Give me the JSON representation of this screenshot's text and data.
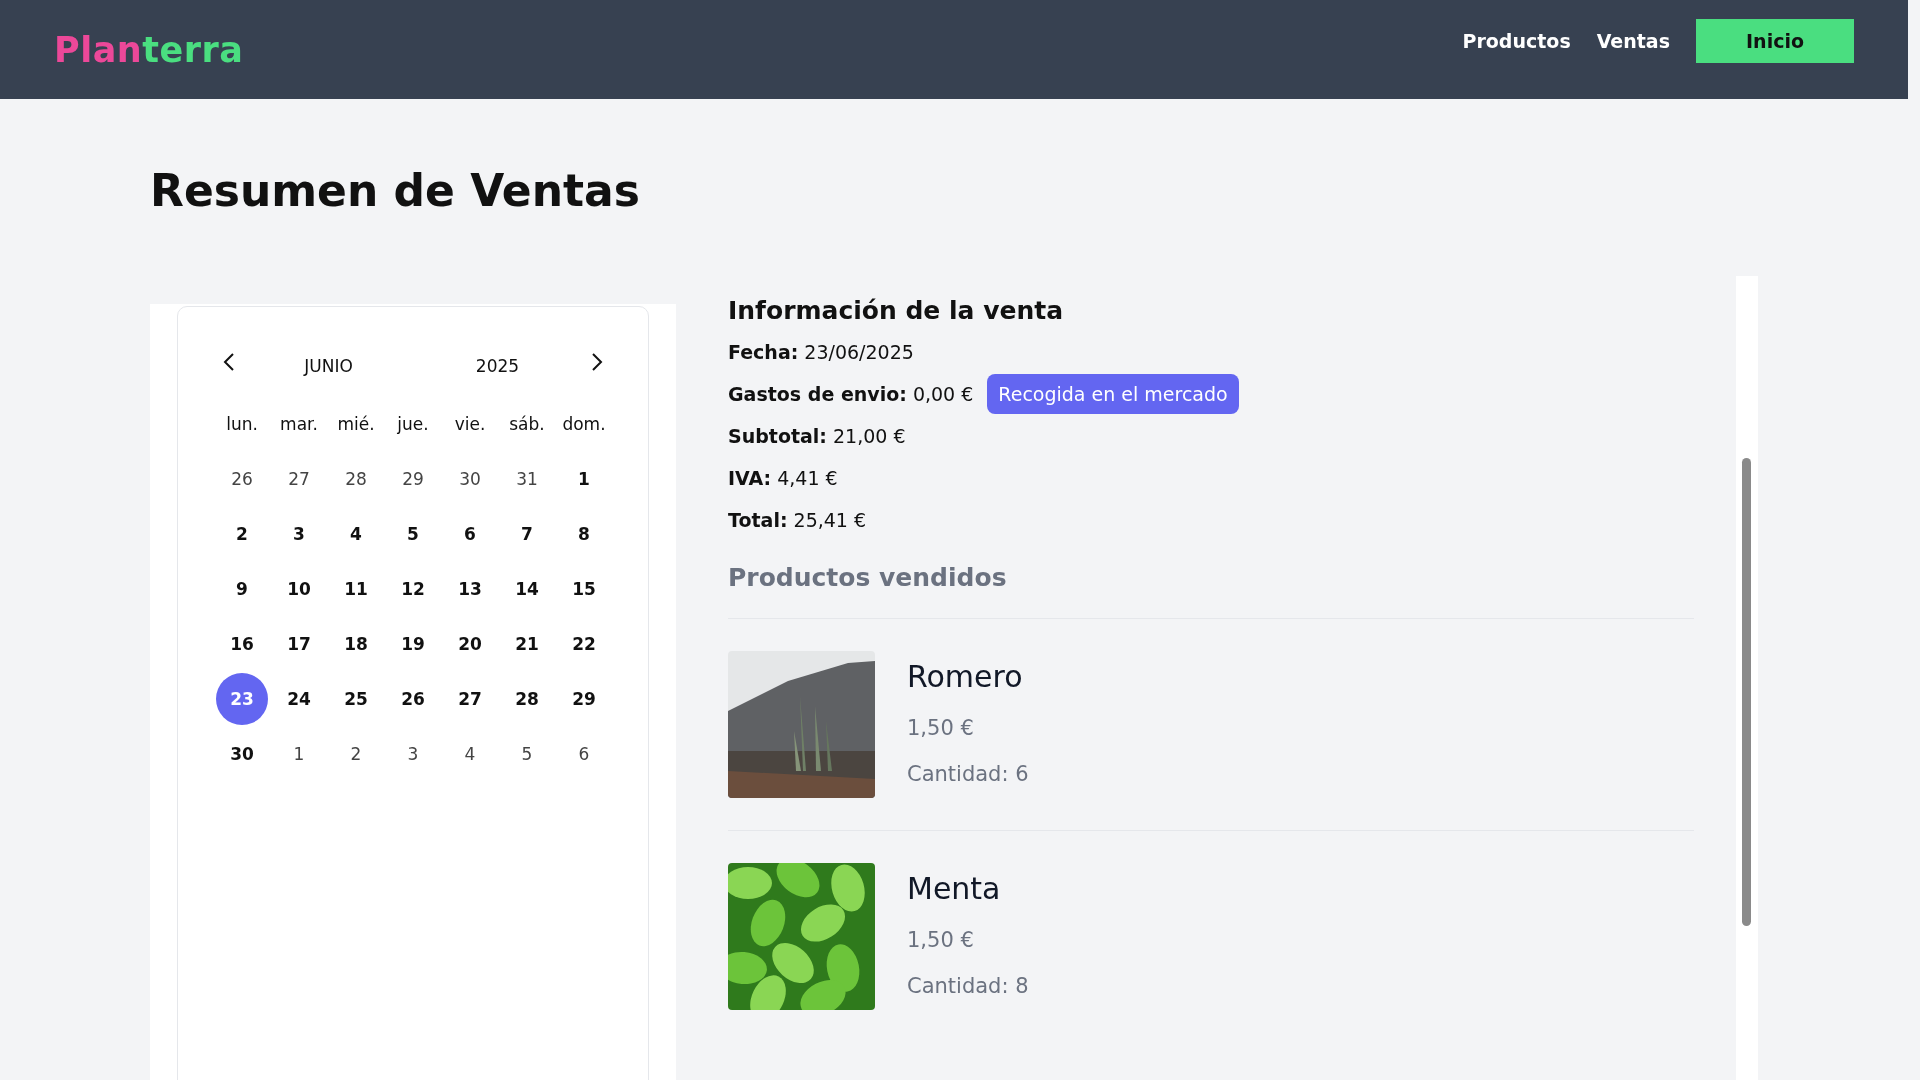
{
  "header": {
    "logo": [
      {
        "text": "Plan",
        "color": "#ec4899"
      },
      {
        "text": "terra",
        "color": "#4ade80"
      }
    ],
    "nav": [
      {
        "label": "Productos",
        "kind": "link"
      },
      {
        "label": "Ventas",
        "kind": "link"
      },
      {
        "label": "Inicio",
        "kind": "button"
      }
    ]
  },
  "page_title": "Resumen de Ventas",
  "calendar": {
    "month": "JUNIO",
    "year": "2025",
    "weekdays": [
      "lun.",
      "mar.",
      "mié.",
      "jue.",
      "vie.",
      "sáb.",
      "dom."
    ],
    "weeks": [
      [
        {
          "label": "26",
          "outside": true,
          "selected": false
        },
        {
          "label": "27",
          "outside": true,
          "selected": false
        },
        {
          "label": "28",
          "outside": true,
          "selected": false
        },
        {
          "label": "29",
          "outside": true,
          "selected": false
        },
        {
          "label": "30",
          "outside": true,
          "selected": false
        },
        {
          "label": "31",
          "outside": true,
          "selected": false
        },
        {
          "label": "1",
          "outside": false,
          "selected": false
        }
      ],
      [
        {
          "label": "2",
          "outside": false,
          "selected": false
        },
        {
          "label": "3",
          "outside": false,
          "selected": false
        },
        {
          "label": "4",
          "outside": false,
          "selected": false
        },
        {
          "label": "5",
          "outside": false,
          "selected": false
        },
        {
          "label": "6",
          "outside": false,
          "selected": false
        },
        {
          "label": "7",
          "outside": false,
          "selected": false
        },
        {
          "label": "8",
          "outside": false,
          "selected": false
        }
      ],
      [
        {
          "label": "9",
          "outside": false,
          "selected": false
        },
        {
          "label": "10",
          "outside": false,
          "selected": false
        },
        {
          "label": "11",
          "outside": false,
          "selected": false
        },
        {
          "label": "12",
          "outside": false,
          "selected": false
        },
        {
          "label": "13",
          "outside": false,
          "selected": false
        },
        {
          "label": "14",
          "outside": false,
          "selected": false
        },
        {
          "label": "15",
          "outside": false,
          "selected": false
        }
      ],
      [
        {
          "label": "16",
          "outside": false,
          "selected": false
        },
        {
          "label": "17",
          "outside": false,
          "selected": false
        },
        {
          "label": "18",
          "outside": false,
          "selected": false
        },
        {
          "label": "19",
          "outside": false,
          "selected": false
        },
        {
          "label": "20",
          "outside": false,
          "selected": false
        },
        {
          "label": "21",
          "outside": false,
          "selected": false
        },
        {
          "label": "22",
          "outside": false,
          "selected": false
        }
      ],
      [
        {
          "label": "23",
          "outside": false,
          "selected": true
        },
        {
          "label": "24",
          "outside": false,
          "selected": false
        },
        {
          "label": "25",
          "outside": false,
          "selected": false
        },
        {
          "label": "26",
          "outside": false,
          "selected": false
        },
        {
          "label": "27",
          "outside": false,
          "selected": false
        },
        {
          "label": "28",
          "outside": false,
          "selected": false
        },
        {
          "label": "29",
          "outside": false,
          "selected": false
        }
      ],
      [
        {
          "label": "30",
          "outside": false,
          "selected": false
        },
        {
          "label": "1",
          "outside": true,
          "selected": false
        },
        {
          "label": "2",
          "outside": true,
          "selected": false
        },
        {
          "label": "3",
          "outside": true,
          "selected": false
        },
        {
          "label": "4",
          "outside": true,
          "selected": false
        },
        {
          "label": "5",
          "outside": true,
          "selected": false
        },
        {
          "label": "6",
          "outside": true,
          "selected": false
        }
      ]
    ]
  },
  "sale_info": {
    "title": "Información de la venta",
    "fields": [
      {
        "text": "**Fecha:** 23/06/2025"
      },
      {
        "text": "**Gastos de envio:** 0,00 €",
        "badge": "Recogida en el mercado"
      },
      {
        "text": "**Subtotal:** 21,00 €"
      },
      {
        "text": "**IVA:** 4,41 €"
      },
      {
        "text": "**Total:** 25,41 €"
      }
    ]
  },
  "products_title": "Productos vendidos",
  "products": [
    {
      "name": "Romero",
      "price": "1,50 €",
      "quantity": "Cantidad: 6"
    },
    {
      "name": "Menta",
      "price": "1,50 €",
      "quantity": "Cantidad: 8"
    }
  ]
}
